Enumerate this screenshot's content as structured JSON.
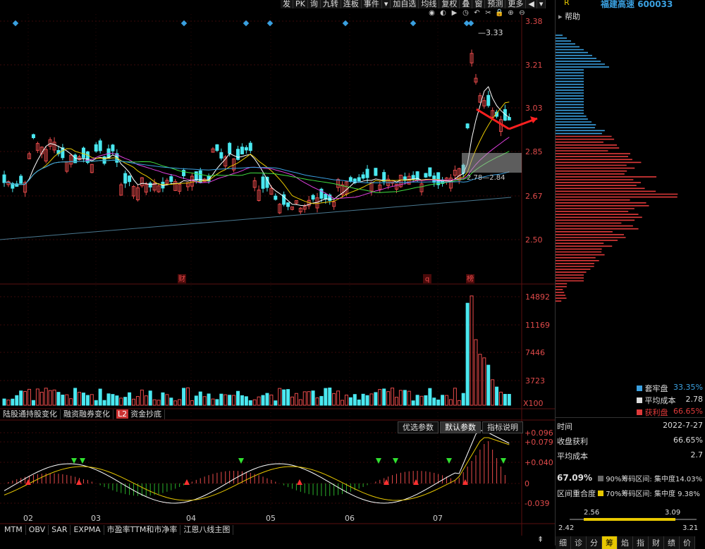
{
  "toolbar": {
    "items": [
      "发",
      "PK",
      "询",
      "九转",
      "连板",
      "事件",
      "▾",
      "加自选",
      "均线",
      "复权",
      "叠",
      "窗",
      "预测",
      "更多",
      "◀",
      "▾"
    ]
  },
  "stock": {
    "name": "福建高速",
    "code": "600033",
    "right_label": "R",
    "help": "帮助"
  },
  "price_axis": [
    "3.38",
    "3.21",
    "3.03",
    "2.85",
    "2.67",
    "2.50"
  ],
  "annotations": {
    "high": "3.33",
    "range": "2.78—2.84",
    "cai": "财",
    "q": "q",
    "bang": "榜"
  },
  "volume_axis": [
    "14892",
    "11169",
    "7446",
    "3723"
  ],
  "volume_unit": "X100",
  "tabs_mid": [
    "陆股通持股变化",
    "融资融券变化",
    "资金抄底"
  ],
  "l2_badge": "L2",
  "param_buttons": [
    "优选参数",
    "默认参数",
    "指标说明"
  ],
  "macd_axis": [
    "+0.096",
    "+0.079",
    "+0.040",
    "0",
    "-0.039"
  ],
  "months": [
    "02",
    "03",
    "04",
    "05",
    "06",
    "07"
  ],
  "bottom_tabs": [
    "MTM",
    "OBV",
    "SAR",
    "EXPMA",
    "市盈率TTM和市净率",
    "江恩八线主图"
  ],
  "right": {
    "legend": [
      {
        "label": "套牢盘",
        "value": "33.35%",
        "color": "#3aa0e0"
      },
      {
        "label": "平均成本",
        "value": "2.78",
        "color": "#dddddd"
      },
      {
        "label": "获利盘",
        "value": "66.65%",
        "color": "#e03a3a"
      }
    ],
    "time_label": "时间",
    "time_value": "2022-7-27",
    "profit_label": "收盘获利",
    "profit_value": "66.65%",
    "avg_label": "平均成本",
    "avg_value": "2.7",
    "pct": "67.09%",
    "r90": "90%筹码区间: 集中度14.03%",
    "overlap": "区间重合度",
    "r70": "70%筹码区间: 集中度 9.38%",
    "range_top_left": "2.56",
    "range_top_right": "3.09",
    "range_bottom_left": "2.42",
    "range_bottom_right": "3.21",
    "bottom_tabs": [
      "细",
      "诊",
      "分",
      "筹",
      "焰",
      "指",
      "财",
      "绩",
      "价"
    ]
  }
}
